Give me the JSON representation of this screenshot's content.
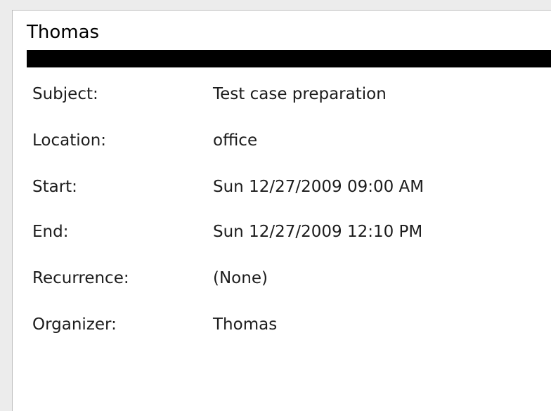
{
  "header": {
    "name": "Thomas"
  },
  "details": [
    {
      "label": "Subject:",
      "value": "Test case preparation"
    },
    {
      "label": "Location:",
      "value": "office"
    },
    {
      "label": "Start:",
      "value": "Sun 12/27/2009 09:00 AM"
    },
    {
      "label": "End:",
      "value": "Sun 12/27/2009 12:10 PM"
    },
    {
      "label": "Recurrence:",
      "value": "(None)"
    },
    {
      "label": "Organizer:",
      "value": "Thomas"
    }
  ]
}
